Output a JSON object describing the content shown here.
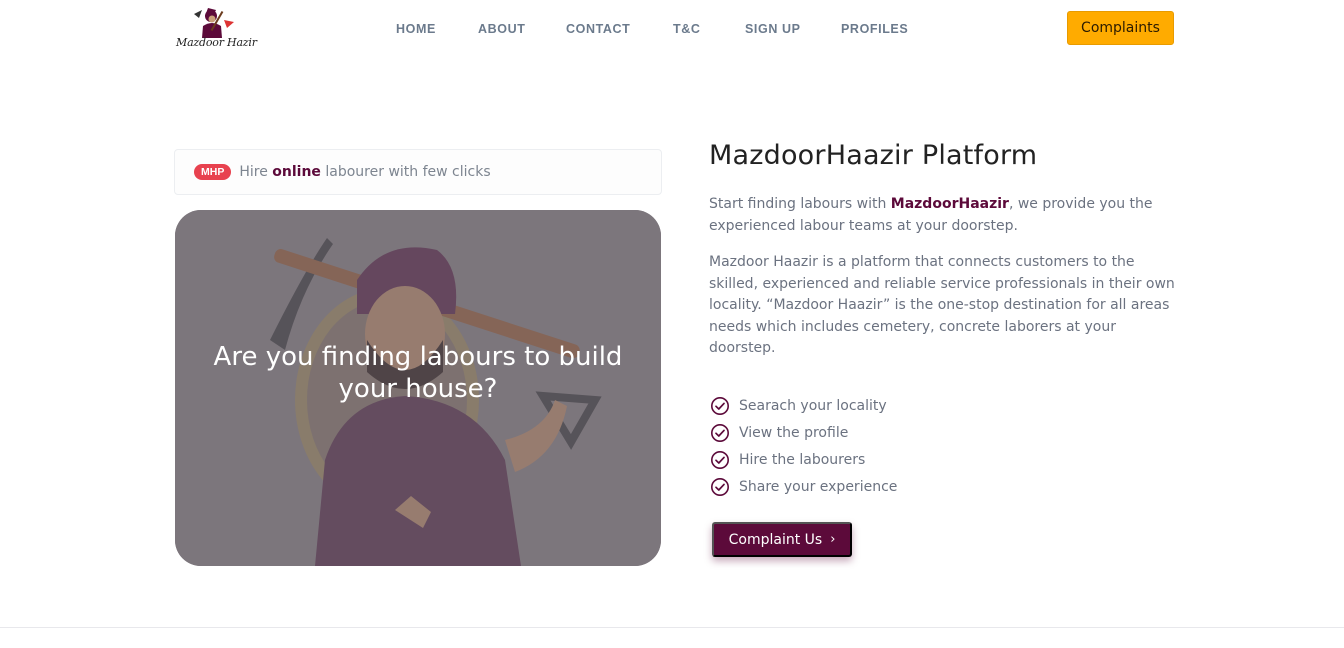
{
  "brand": {
    "logo_text": "Mazdoor Hazir"
  },
  "nav": {
    "items": [
      {
        "label": "HOME"
      },
      {
        "label": "ABOUT"
      },
      {
        "label": "CONTACT"
      },
      {
        "label": "T&C"
      },
      {
        "label": "SIGN UP"
      },
      {
        "label": "PROFILES"
      }
    ],
    "cta_label": "Complaints"
  },
  "hero": {
    "badge": "MHP",
    "tagline_prefix": "Hire",
    "tagline_highlight": "online",
    "tagline_suffix": "labourer with few clicks",
    "image_caption": "Are you finding labours to build your house?"
  },
  "about": {
    "title": "MazdoorHaazir Platform",
    "intro_prefix": "Start finding labours with",
    "intro_brand": "MazdoorHaazir",
    "intro_suffix": ", we provide you the experienced labour teams at your doorstep.",
    "description": "Mazdoor Haazir is a platform that connects customers to the skilled, experienced and reliable service professionals in their own locality. “Mazdoor Haazir” is the one-stop destination for all areas needs which includes cemetery, concrete laborers at your doorstep.",
    "features": [
      {
        "label": "Searach your locality"
      },
      {
        "label": "View the profile"
      },
      {
        "label": "Hire the labourers"
      },
      {
        "label": "Share your experience"
      }
    ],
    "button_label": "Complaint Us",
    "button_chevron": "›"
  },
  "colors": {
    "accent": "#ffab00",
    "brand": "#5c0a3a",
    "badge": "#e8424f",
    "nav_text": "#6b7a8c",
    "body_text": "#6b7280"
  },
  "icons": {
    "feature": "check-circle-icon",
    "button": "chevron-right-icon"
  }
}
